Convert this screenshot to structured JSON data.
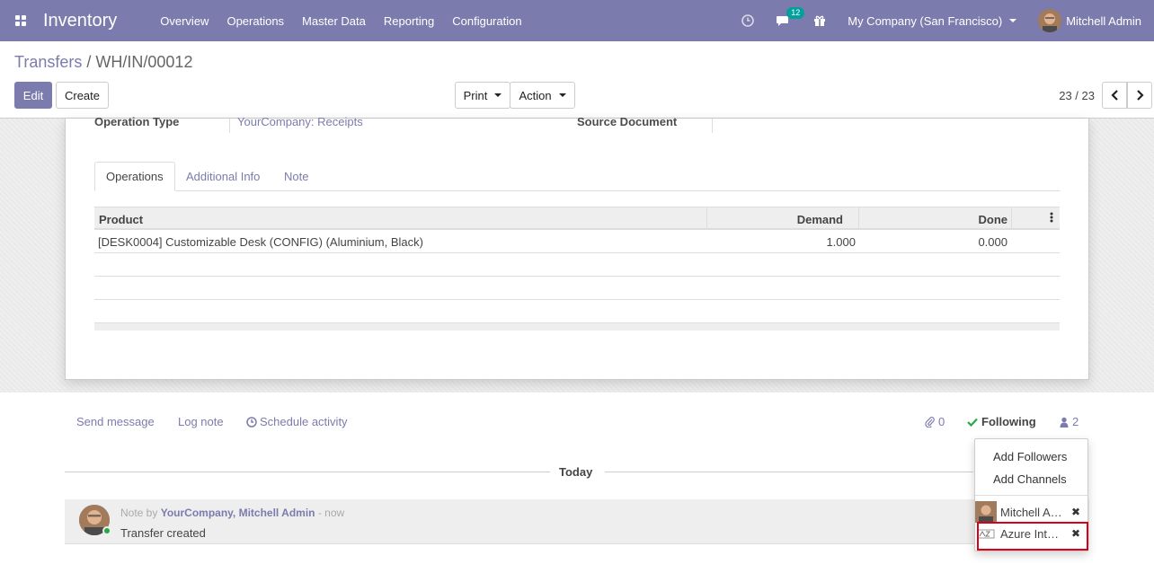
{
  "navbar": {
    "app_name": "Inventory",
    "menu": [
      "Overview",
      "Operations",
      "Master Data",
      "Reporting",
      "Configuration"
    ],
    "messages_count": "12",
    "company": "My Company (San Francisco)",
    "user": "Mitchell Admin"
  },
  "breadcrumb": {
    "parent": "Transfers",
    "separator": "/",
    "current": "WH/IN/00012"
  },
  "buttons": {
    "edit": "Edit",
    "create": "Create",
    "print": "Print",
    "action": "Action"
  },
  "pager": {
    "text": "23 / 23"
  },
  "form": {
    "operation_type_label": "Operation Type",
    "operation_type_value": "YourCompany: Receipts",
    "source_document_label": "Source Document",
    "tabs": [
      "Operations",
      "Additional Info",
      "Note"
    ],
    "table": {
      "headers": {
        "product": "Product",
        "demand": "Demand",
        "done": "Done"
      },
      "rows": [
        {
          "product": "[DESK0004] Customizable Desk (CONFIG) (Aluminium, Black)",
          "demand": "1.000",
          "done": "0.000"
        }
      ]
    }
  },
  "chatter": {
    "send_message": "Send message",
    "log_note": "Log note",
    "schedule_activity": "Schedule activity",
    "attachments_count": "0",
    "following": "Following",
    "followers_count": "2",
    "today": "Today",
    "message": {
      "prefix": "Note by",
      "author": "YourCompany, Mitchell Admin",
      "time": "- now",
      "body": "Transfer created"
    }
  },
  "followers_dropdown": {
    "add_followers": "Add Followers",
    "add_channels": "Add Channels",
    "followers": [
      "Mitchell A…",
      "Azure Int…"
    ],
    "remove_glyph": "✖"
  },
  "colors": {
    "brand": "#7c7bad",
    "teal_badge": "#00a09d",
    "highlight": "#d9001b",
    "following_check": "#28a745"
  }
}
